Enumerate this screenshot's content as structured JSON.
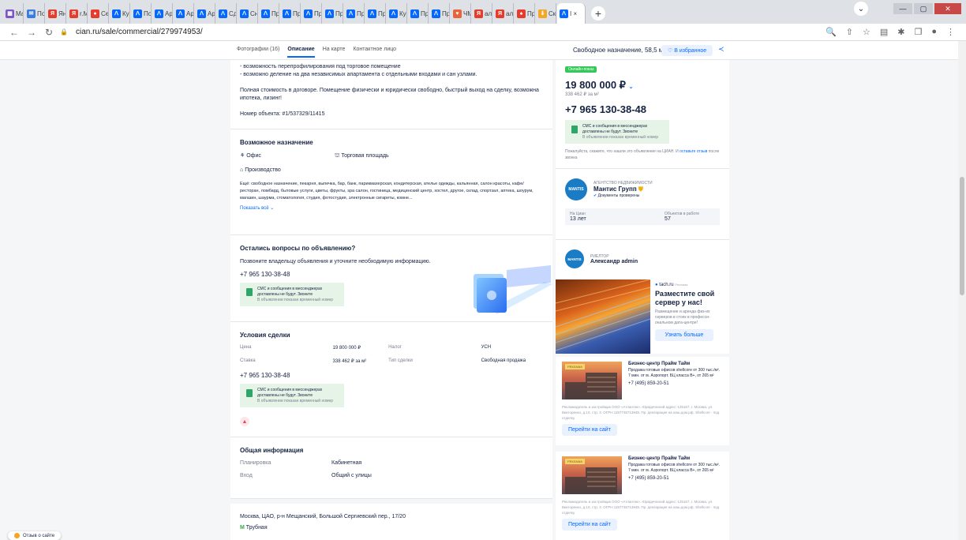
{
  "browser": {
    "tabs": [
      {
        "label": "Mai",
        "color": "#7d55c7",
        "glyph": "▦"
      },
      {
        "label": "По",
        "color": "#3b7ddd",
        "glyph": "✉"
      },
      {
        "label": "Янд",
        "color": "#e63c2b",
        "glyph": "Я"
      },
      {
        "label": "r.M",
        "color": "#e63c2b",
        "glyph": "Я"
      },
      {
        "label": "Сел",
        "color": "#e63c2b",
        "glyph": "●"
      },
      {
        "label": "Куп",
        "color": "#0468ff",
        "glyph": "ᐱ"
      },
      {
        "label": "Пок",
        "color": "#0468ff",
        "glyph": "ᐱ"
      },
      {
        "label": "Аре",
        "color": "#0468ff",
        "glyph": "ᐱ"
      },
      {
        "label": "Аре",
        "color": "#0468ff",
        "glyph": "ᐱ"
      },
      {
        "label": "Аре",
        "color": "#0468ff",
        "glyph": "ᐱ"
      },
      {
        "label": "Сда",
        "color": "#0468ff",
        "glyph": "ᐱ"
      },
      {
        "label": "Сни",
        "color": "#0468ff",
        "glyph": "ᐱ"
      },
      {
        "label": "Прс",
        "color": "#0468ff",
        "glyph": "ᐱ"
      },
      {
        "label": "Прс",
        "color": "#0468ff",
        "glyph": "ᐱ"
      },
      {
        "label": "Прс",
        "color": "#0468ff",
        "glyph": "ᐱ"
      },
      {
        "label": "Прс",
        "color": "#0468ff",
        "glyph": "ᐱ"
      },
      {
        "label": "Прс",
        "color": "#0468ff",
        "glyph": "ᐱ"
      },
      {
        "label": "Прс",
        "color": "#0468ff",
        "glyph": "ᐱ"
      },
      {
        "label": "Куп",
        "color": "#0468ff",
        "glyph": "ᐱ"
      },
      {
        "label": "Прс",
        "color": "#0468ff",
        "glyph": "ᐱ"
      },
      {
        "label": "Прс",
        "color": "#0468ff",
        "glyph": "ᐱ"
      },
      {
        "label": "ЧМ",
        "color": "#e8643a",
        "glyph": "♥"
      },
      {
        "label": "ала",
        "color": "#e63c2b",
        "glyph": "Я"
      },
      {
        "label": "ала",
        "color": "#e63c2b",
        "glyph": "Я"
      },
      {
        "label": "Прс",
        "color": "#e63c2b",
        "glyph": "♠"
      },
      {
        "label": "Ска",
        "color": "#f5a623",
        "glyph": "⬇"
      },
      {
        "label": "I ×",
        "color": "#0468ff",
        "glyph": "ᐱ",
        "active": true
      }
    ],
    "url": "cian.ru/sale/commercial/279974953/"
  },
  "subnav": {
    "tabs": [
      "Фотографии (16)",
      "Описание",
      "На карте",
      "Контактное лицо"
    ],
    "summary": "Свободное назначение, 58,5 м²",
    "favorite": "В избранное"
  },
  "description": {
    "line1": "- возможность перепрофилирования под торговое помещение",
    "line2": "- возможно деление на два независимых апартамента с отдельными входами и сан узлами.",
    "para": "Полная стоимость в договоре. Помещение физически и юридически свободно, быстрый выход на сделку, возможна ипотека, лизинг!",
    "object": "Номер объекта: #1/537329/11415"
  },
  "purpose": {
    "title": "Возможное назначение",
    "items": [
      "Офис",
      "Торговая площадь",
      "Производство"
    ],
    "more": "Ещё: свободное назначение, пекарня, выпечка, бар, банк, парикмахерская, кондитерская, ателье одежды, кальянная, салон красоты, кафе/ресторан, ломбард, бытовые услуги, цветы, фрукты, spa салон, гостиница, медицинский центр, хостел, другое, склад, спортзал, аптека, шоурум, магазин, шаурма, стоматология, студия, фотостудия, электронные сигареты, комне...",
    "show_all": "Показать всё"
  },
  "questions": {
    "title": "Остались вопросы по объявлению?",
    "text": "Позвоните владельцу объявления и уточните необходимую информацию.",
    "phone": "+7 965 130-38-48"
  },
  "sms": {
    "line1": "СМС и сообщения в мессенджерах",
    "line2": "доставлены не будут. Звоните",
    "line3": "В объявлении показан временный номер"
  },
  "deal": {
    "title": "Условия сделки",
    "rows": [
      {
        "k1": "Цена",
        "v1": "19 800 000 ₽",
        "k2": "Налог",
        "v2": "УСН"
      },
      {
        "k1": "Ставка",
        "v1": "338 462 ₽ за м²",
        "k2": "Тип сделки",
        "v2": "Свободная продажа"
      }
    ],
    "phone": "+7 965 130-38-48"
  },
  "general": {
    "title": "Общая информация",
    "rows": [
      {
        "k": "Планировка",
        "v": "Кабинетная"
      },
      {
        "k": "Вход",
        "v": "Общий с улицы"
      }
    ]
  },
  "address": {
    "text": "Москва, ЦАО, р-н Мещанский, Большой Сергиевский пер., 17/20",
    "metro": "Трубная"
  },
  "price_card": {
    "badge": "Онлайн-показ",
    "price": "19 800 000 ₽",
    "per_m": "338 462 ₽ за м²",
    "phone": "+7 965 130-38-48",
    "note": "Пожалуйста, скажите, что нашли это объявление на ЦИАН. И",
    "note_link": "оставьте отзыв",
    "note_end": "после звонка"
  },
  "agency": {
    "kind": "АГЕНТСТВО НЕДВИЖИМОСТИ",
    "name": "Мантис Групп",
    "verified": "Документы проверены",
    "logo": "MANTIS",
    "on_cian_label": "На Циан",
    "on_cian": "13 лет",
    "objects_label": "Объектов в работе",
    "objects": "57"
  },
  "realtor": {
    "kind": "РИЕЛТОР",
    "name": "Александр admin",
    "logo": "MANTIS"
  },
  "ad_tach": {
    "source": "tach.ru",
    "tag": "Реклама",
    "title": "Разместите свой сервер у нас!",
    "text": "Размещение и аренда физ-их серверов в стоек в професси-ональном дата-центре!",
    "button": "Узнать больше"
  },
  "ad_prime": {
    "tag": "РЕКЛАМА",
    "title": "Бизнес-центр Прайм Тайм",
    "text": "Продажа готовых офисов shellcore от 300 тыс./м². 7 мин. от м. Аэропорт. БЦ класса B+, от 265 м²",
    "phone": "+7 (495) 859-20-51",
    "legal": "Рекламодатель и застройщик ООО «Атлантик». Юридический адрес: 125167, г. Москва, ул. Викторенко, д.10, стр. 3. ОГРН 1157746713948. Пр. декларация на наш.дом.рф. Shellcore - под отделку",
    "button": "Перейти на сайт"
  },
  "feedback": "Отзыв о сайте"
}
